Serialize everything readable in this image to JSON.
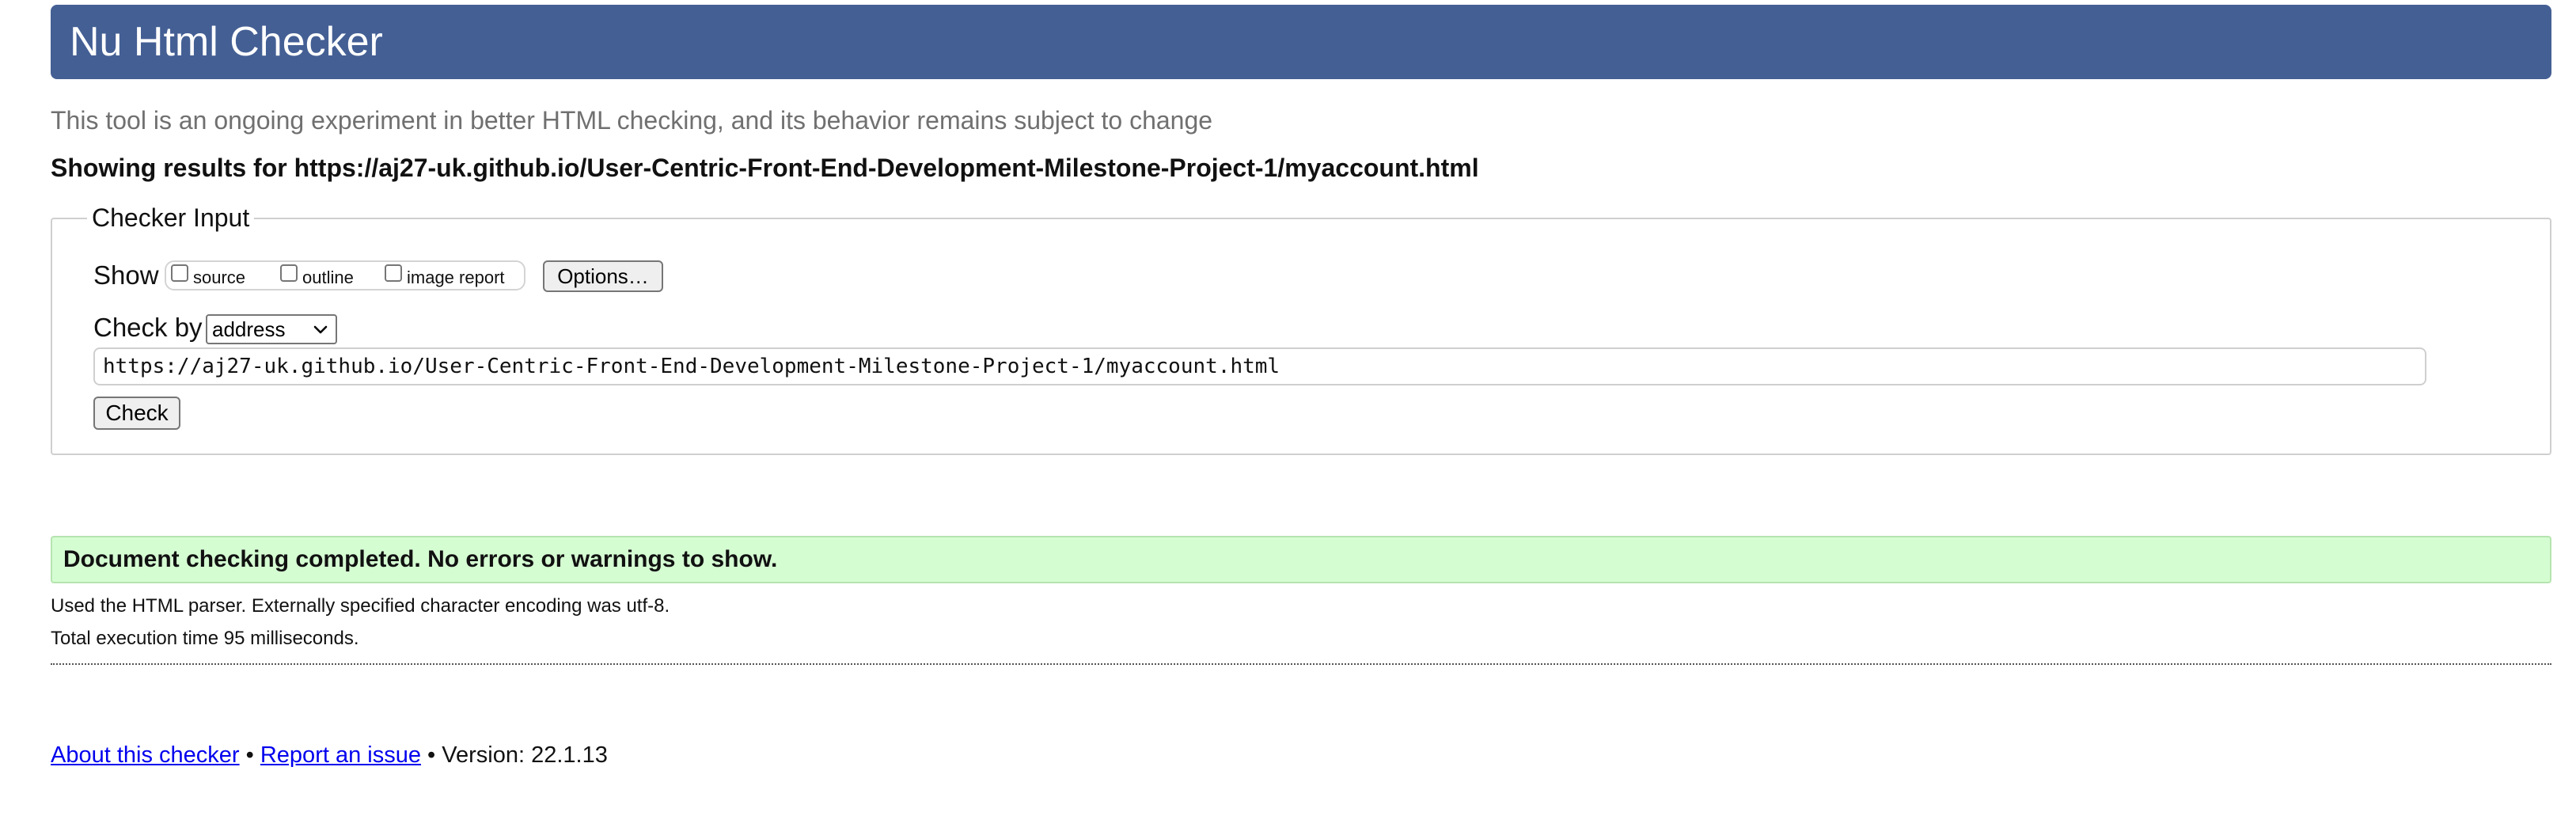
{
  "header": {
    "title": "Nu Html Checker"
  },
  "subtitle": "This tool is an ongoing experiment in better HTML checking, and its behavior remains subject to change",
  "results_heading": "Showing results for https://aj27-uk.github.io/User-Centric-Front-End-Development-Milestone-Project-1/myaccount.html",
  "checker_input": {
    "legend": "Checker Input",
    "show_label": "Show",
    "show_options": [
      {
        "label": "source",
        "checked": false
      },
      {
        "label": "outline",
        "checked": false
      },
      {
        "label": "image report",
        "checked": false
      }
    ],
    "options_button": "Options…",
    "check_by_label": "Check by",
    "check_by_selected": "address",
    "url_value": "https://aj27-uk.github.io/User-Centric-Front-End-Development-Milestone-Project-1/myaccount.html",
    "check_button": "Check"
  },
  "result": {
    "message": "Document checking completed. No errors or warnings to show.",
    "parser_info": "Used the HTML parser. Externally specified character encoding was utf-8.",
    "execution_time": "Total execution time 95 milliseconds."
  },
  "footer": {
    "about_link": "About this checker",
    "separator": " • ",
    "report_link": "Report an issue",
    "version": "Version: 22.1.13"
  },
  "colors": {
    "header_bg": "#445f94",
    "success_bg": "#d5fdd2",
    "link": "#0000ee"
  }
}
